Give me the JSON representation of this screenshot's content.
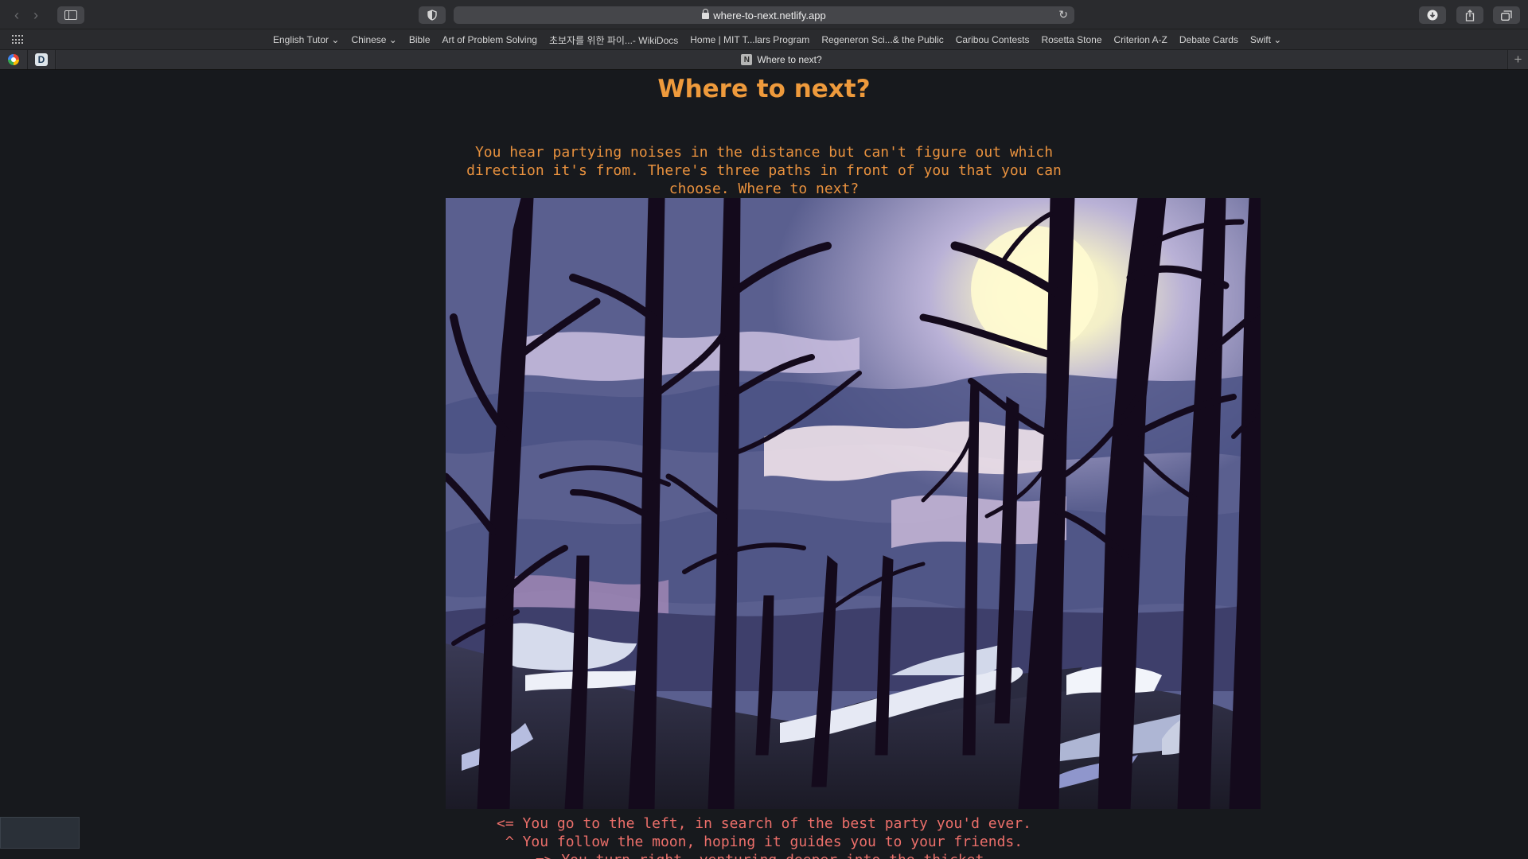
{
  "browser": {
    "url": "where-to-next.netlify.app",
    "bookmarks": [
      "English Tutor ⌄",
      "Chinese ⌄",
      "Bible",
      "Art of Problem Solving",
      "초보자를 위한 파이...- WikiDocs",
      "Home | MIT T...lars Program",
      "Regeneron Sci...& the Public",
      "Caribou Contests",
      "Rosetta Stone",
      "Criterion A-Z",
      "Debate Cards",
      "Swift ⌄"
    ],
    "active_tab": "Where to next?",
    "tab_favicon": "N",
    "pinned_d_letter": "D"
  },
  "page": {
    "title": "Where to next?",
    "prompt": "You hear partying noises in the distance but can't figure out which direction it's from. There's three paths in front of you that you can choose. Where to next?",
    "scene_image": "moonlit-forest-illustration",
    "choices": [
      "<= You go to the left, in search of the best party you'd ever.",
      "^ You follow the moon, hoping it guides you to your friends.",
      "=> You turn right, venturing deeper into the thicket."
    ]
  },
  "colors": {
    "title": "#ee9a3c",
    "prompt": "#e8913e",
    "choices": "#ec6f6a",
    "background": "#17191d"
  }
}
